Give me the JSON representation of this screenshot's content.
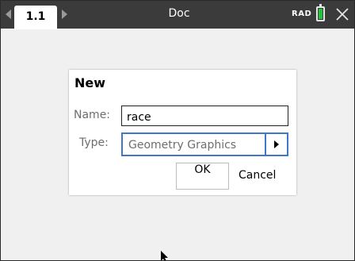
{
  "titlebar": {
    "tab_label": "1.1",
    "document_title": "Doc",
    "angle_mode": "RAD",
    "battery_color": "#22c23a",
    "icons": [
      "chevron-left-icon",
      "chevron-right-icon",
      "battery-icon",
      "close-icon"
    ]
  },
  "dialog": {
    "title": "New",
    "name_label": "Name:",
    "name_value": "race",
    "type_label": "Type:",
    "type_value": "Geometry Graphics",
    "ok_label": "OK",
    "cancel_label": "Cancel",
    "accent_color": "#3f78c9"
  },
  "pointer": {
    "icon": "cursor-arrow-icon"
  }
}
